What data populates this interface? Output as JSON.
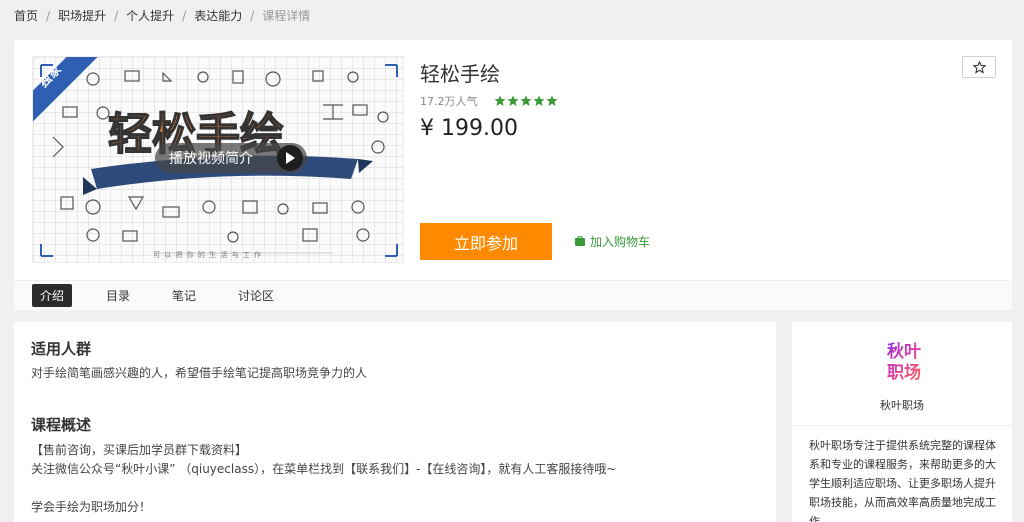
{
  "breadcrumb": {
    "items": [
      "首页",
      "职场提升",
      "个人提升",
      "表达能力"
    ],
    "current": "课程详情",
    "separator": "/"
  },
  "course": {
    "badge": "独家",
    "title": "轻松手绘",
    "popularity": "17.2万人气",
    "rating_stars": 5,
    "price": "¥ 199.00",
    "cover": {
      "title_art": "轻松手绘",
      "play_label": "播放视频简介",
      "footer": "可 以 把 你 的 生 活 与 工 作"
    },
    "join_label": "立即参加",
    "cart_label": "加入购物车",
    "favorite_icon": "star-outline-icon"
  },
  "tabs": [
    "介绍",
    "目录",
    "笔记",
    "讨论区"
  ],
  "active_tab": 0,
  "intro": {
    "audience_title": "适用人群",
    "audience_text": "对手绘简笔画感兴趣的人，希望借手绘笔记提高职场竞争力的人",
    "overview_title": "课程概述",
    "overview_line1": "【售前咨询，买课后加学员群下载资料】",
    "overview_line2": "关注微信公众号“秋叶小课” （qiuyeclass），在菜单栏找到【联系我们】-【在线咨询】，就有人工客服接待哦~",
    "overview_line3": "学会手绘为职场加分！"
  },
  "provider": {
    "logo_text_1": "秋叶",
    "logo_text_2": "职场",
    "name": "秋叶职场",
    "description": "秋叶职场专注于提供系统完整的课程体系和专业的课程服务，来帮助更多的大学生顺利适应职场、让更多职场人提升职场技能，从而高效率高质量地完成工作。"
  },
  "colors": {
    "accent_orange": "#ff8a00",
    "star_green": "#3a9a3a",
    "badge_blue": "#2f5fb3",
    "tab_active_bg": "#2b2b2b"
  }
}
